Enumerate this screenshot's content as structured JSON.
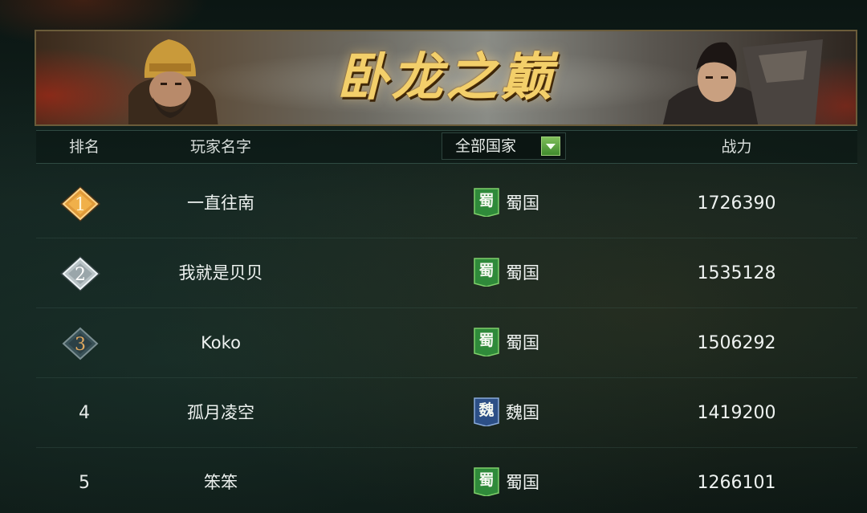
{
  "banner": {
    "title": "卧龙之巅"
  },
  "header": {
    "rank": "排名",
    "player_name": "玩家名字",
    "nation_filter": "全部国家",
    "power": "战力"
  },
  "rows": [
    {
      "rank": "1",
      "name": "一直往南",
      "nation_char": "蜀",
      "nation": "蜀国",
      "power": "1726390"
    },
    {
      "rank": "2",
      "name": "我就是贝贝",
      "nation_char": "蜀",
      "nation": "蜀国",
      "power": "1535128"
    },
    {
      "rank": "3",
      "name": "Koko",
      "nation_char": "蜀",
      "nation": "蜀国",
      "power": "1506292"
    },
    {
      "rank": "4",
      "name": "孤月凌空",
      "nation_char": "魏",
      "nation": "魏国",
      "power": "1419200"
    },
    {
      "rank": "5",
      "name": "笨笨",
      "nation_char": "蜀",
      "nation": "蜀国",
      "power": "1266101"
    }
  ],
  "colors": {
    "shu_badge": "#2f8a3a",
    "wei_badge": "#2c4f86",
    "gold_medal": "#e09a3a",
    "silver_medal": "#b9c3c6",
    "bronze_medal": "#3a5258",
    "title_gold": "#f3cf6a"
  }
}
